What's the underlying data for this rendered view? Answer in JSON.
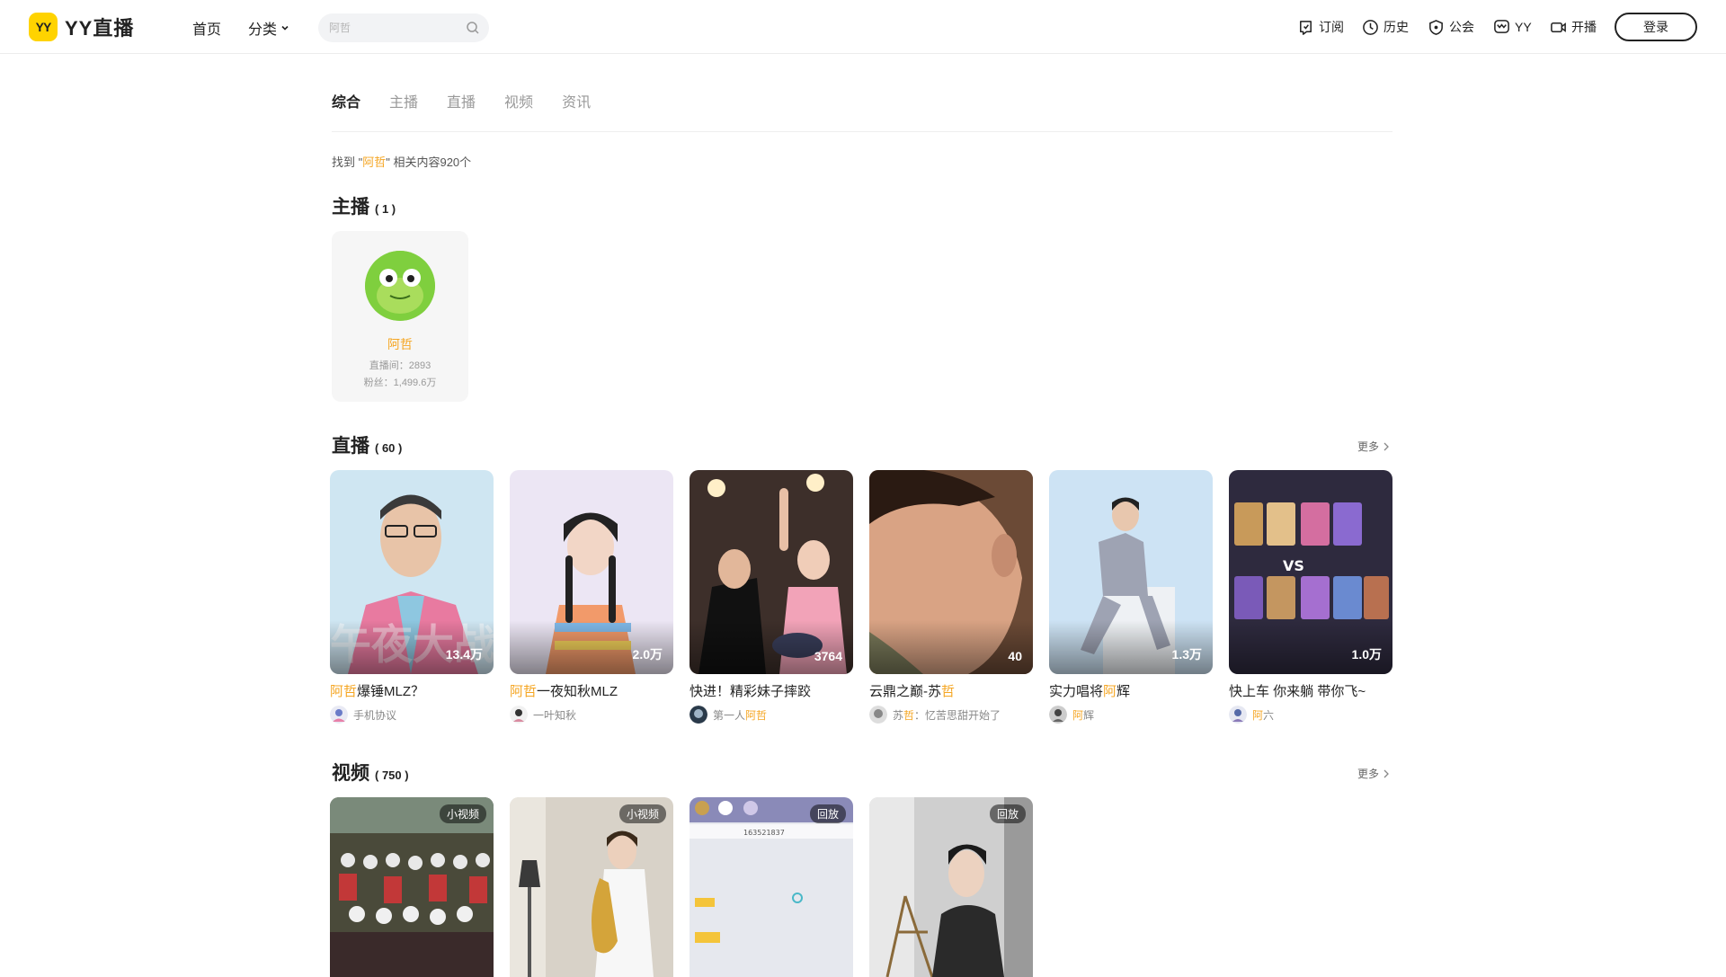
{
  "header": {
    "logo_badge": "YY",
    "logo_text": "YY直播",
    "nav_home": "首页",
    "nav_category": "分类",
    "search_placeholder": "阿哲",
    "subscribe": "订阅",
    "history": "历史",
    "guild": "公会",
    "yy": "YY",
    "broadcast": "开播",
    "login": "登录"
  },
  "tabs": [
    "综合",
    "主播",
    "直播",
    "视频",
    "资讯"
  ],
  "active_tab": "综合",
  "result": {
    "prefix": "找到 \"",
    "keyword": "阿哲",
    "suffix": "\" 相关内容920个"
  },
  "anchors_section": {
    "title": "主播",
    "count": "( 1 )"
  },
  "anchor": {
    "name": "阿哲",
    "room": "直播间：2893",
    "fans": "粉丝：1,499.6万"
  },
  "live_section": {
    "title": "直播",
    "count": "( 60 )",
    "more": "更多"
  },
  "live": [
    {
      "title_hl": "阿哲",
      "title_rest": "爆锤MLZ？",
      "count": "13.4万",
      "user_hl": "",
      "user_rest": "手机协议"
    },
    {
      "title_hl": "阿哲",
      "title_rest": "一夜知秋MLZ",
      "count": "2.0万",
      "user_hl": "",
      "user_rest": "一叶知秋"
    },
    {
      "title_pre": "快进！精彩妹子摔跤",
      "count": "3764",
      "user_pre": "第一人",
      "user_hl": "阿哲"
    },
    {
      "title_pre": "云鼎之巅-苏",
      "title_hl": "哲",
      "count": "40",
      "user_pre": "苏",
      "user_hl": "哲",
      "user_rest": "：忆苦思甜开始了"
    },
    {
      "title_pre": "实力唱将",
      "title_hl": "阿",
      "title_rest": "辉",
      "count": "1.3万",
      "user_hl": "阿",
      "user_rest": "辉"
    },
    {
      "title_pre": "快上车 你来躺 带你飞~",
      "count": "1.0万",
      "user_hl": "阿",
      "user_rest": "六"
    }
  ],
  "video_section": {
    "title": "视频",
    "count": "( 750 )",
    "more": "更多"
  },
  "videos": [
    {
      "tag": "小视频"
    },
    {
      "tag": "小视频"
    },
    {
      "tag": "回放",
      "overlay_id": "163521837"
    },
    {
      "tag": "回放"
    }
  ],
  "colors": {
    "accent": "#f5a623",
    "brand": "#ffd300"
  }
}
